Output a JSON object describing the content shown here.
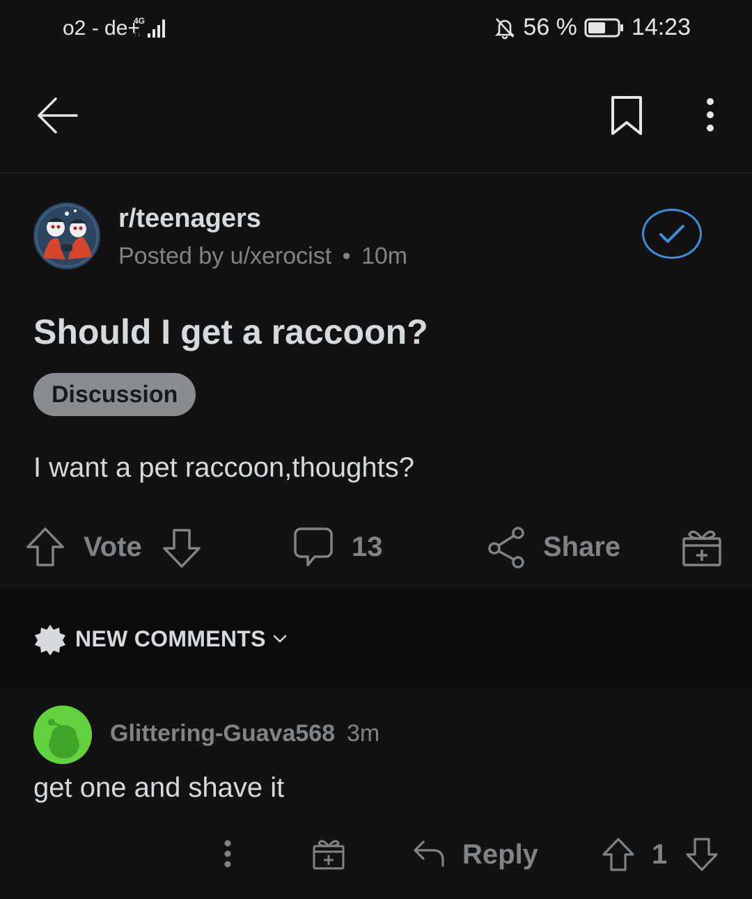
{
  "status_bar": {
    "carrier": "o2 - de+",
    "network": "4G",
    "battery_percent": "56 %",
    "time": "14:23"
  },
  "app_bar": {
    "back_icon": "arrow-left-icon",
    "bookmark_icon": "bookmark-icon",
    "more_icon": "more-vertical-icon"
  },
  "post": {
    "subreddit": "r/teenagers",
    "posted_by_prefix": "Posted by",
    "author": "u/xerocist",
    "separator": "•",
    "age": "10m",
    "joined_icon": "checkmark-icon",
    "title": "Should I get a raccoon?",
    "flair": "Discussion",
    "body": "I want a pet raccoon,thoughts?",
    "actions": {
      "vote_label": "Vote",
      "comment_count": "13",
      "share_label": "Share"
    }
  },
  "sort": {
    "label": "NEW COMMENTS"
  },
  "comments": [
    {
      "author": "Glittering-Guava568",
      "age": "3m",
      "body": "get one and shave it",
      "reply_label": "Reply",
      "score": "1"
    }
  ],
  "colors": {
    "background": "#121212",
    "accent_blue": "#3d8fde",
    "muted": "#818384",
    "text": "#d7dadc",
    "flair_bg": "#8a8c8f",
    "avatar_green": "#62d23f"
  }
}
